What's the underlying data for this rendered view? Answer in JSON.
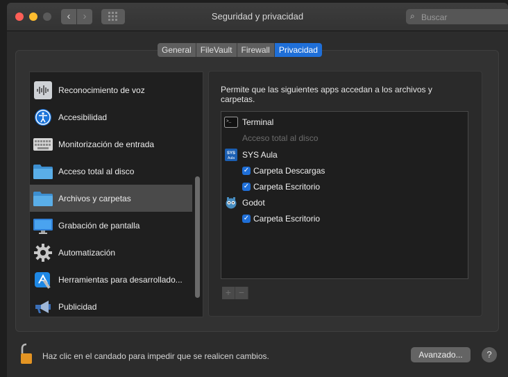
{
  "window": {
    "title": "Seguridad y privacidad"
  },
  "toolbar": {
    "back": "‹",
    "forward": "›",
    "search_placeholder": "Buscar"
  },
  "tabs": [
    {
      "label": "General",
      "active": false
    },
    {
      "label": "FileVault",
      "active": false
    },
    {
      "label": "Firewall",
      "active": false
    },
    {
      "label": "Privacidad",
      "active": true
    }
  ],
  "sidebar": {
    "items": [
      {
        "label": "Reconocimiento de voz",
        "icon": "waveform-icon"
      },
      {
        "label": "Accesibilidad",
        "icon": "accessibility-icon"
      },
      {
        "label": "Monitorización de entrada",
        "icon": "keyboard-icon"
      },
      {
        "label": "Acceso total al disco",
        "icon": "folder-icon"
      },
      {
        "label": "Archivos y carpetas",
        "icon": "folder-icon",
        "selected": true
      },
      {
        "label": "Grabación de pantalla",
        "icon": "display-icon"
      },
      {
        "label": "Automatización",
        "icon": "gear-icon"
      },
      {
        "label": "Herramientas para desarrollado...",
        "icon": "developer-tools-icon"
      },
      {
        "label": "Publicidad",
        "icon": "megaphone-icon"
      }
    ]
  },
  "main": {
    "description": "Permite que las siguientes apps accedan a los archivos y carpetas.",
    "apps": [
      {
        "name": "Terminal",
        "icon": "terminal-icon",
        "subtitle": "Acceso total al disco",
        "folders": []
      },
      {
        "name": "SYS Aula",
        "icon": "sys-aula-icon",
        "folders": [
          {
            "label": "Carpeta Descargas",
            "checked": true
          },
          {
            "label": "Carpeta Escritorio",
            "checked": true
          }
        ]
      },
      {
        "name": "Godot",
        "icon": "godot-icon",
        "folders": [
          {
            "label": "Carpeta Escritorio",
            "checked": true
          }
        ]
      }
    ],
    "add_label": "+",
    "remove_label": "−"
  },
  "footer": {
    "lock_text": "Haz clic en el candado para impedir que se realicen cambios.",
    "advanced_label": "Avanzado...",
    "help_label": "?"
  },
  "colors": {
    "accent": "#1f6fd8",
    "window_bg": "#2c2c2c"
  }
}
